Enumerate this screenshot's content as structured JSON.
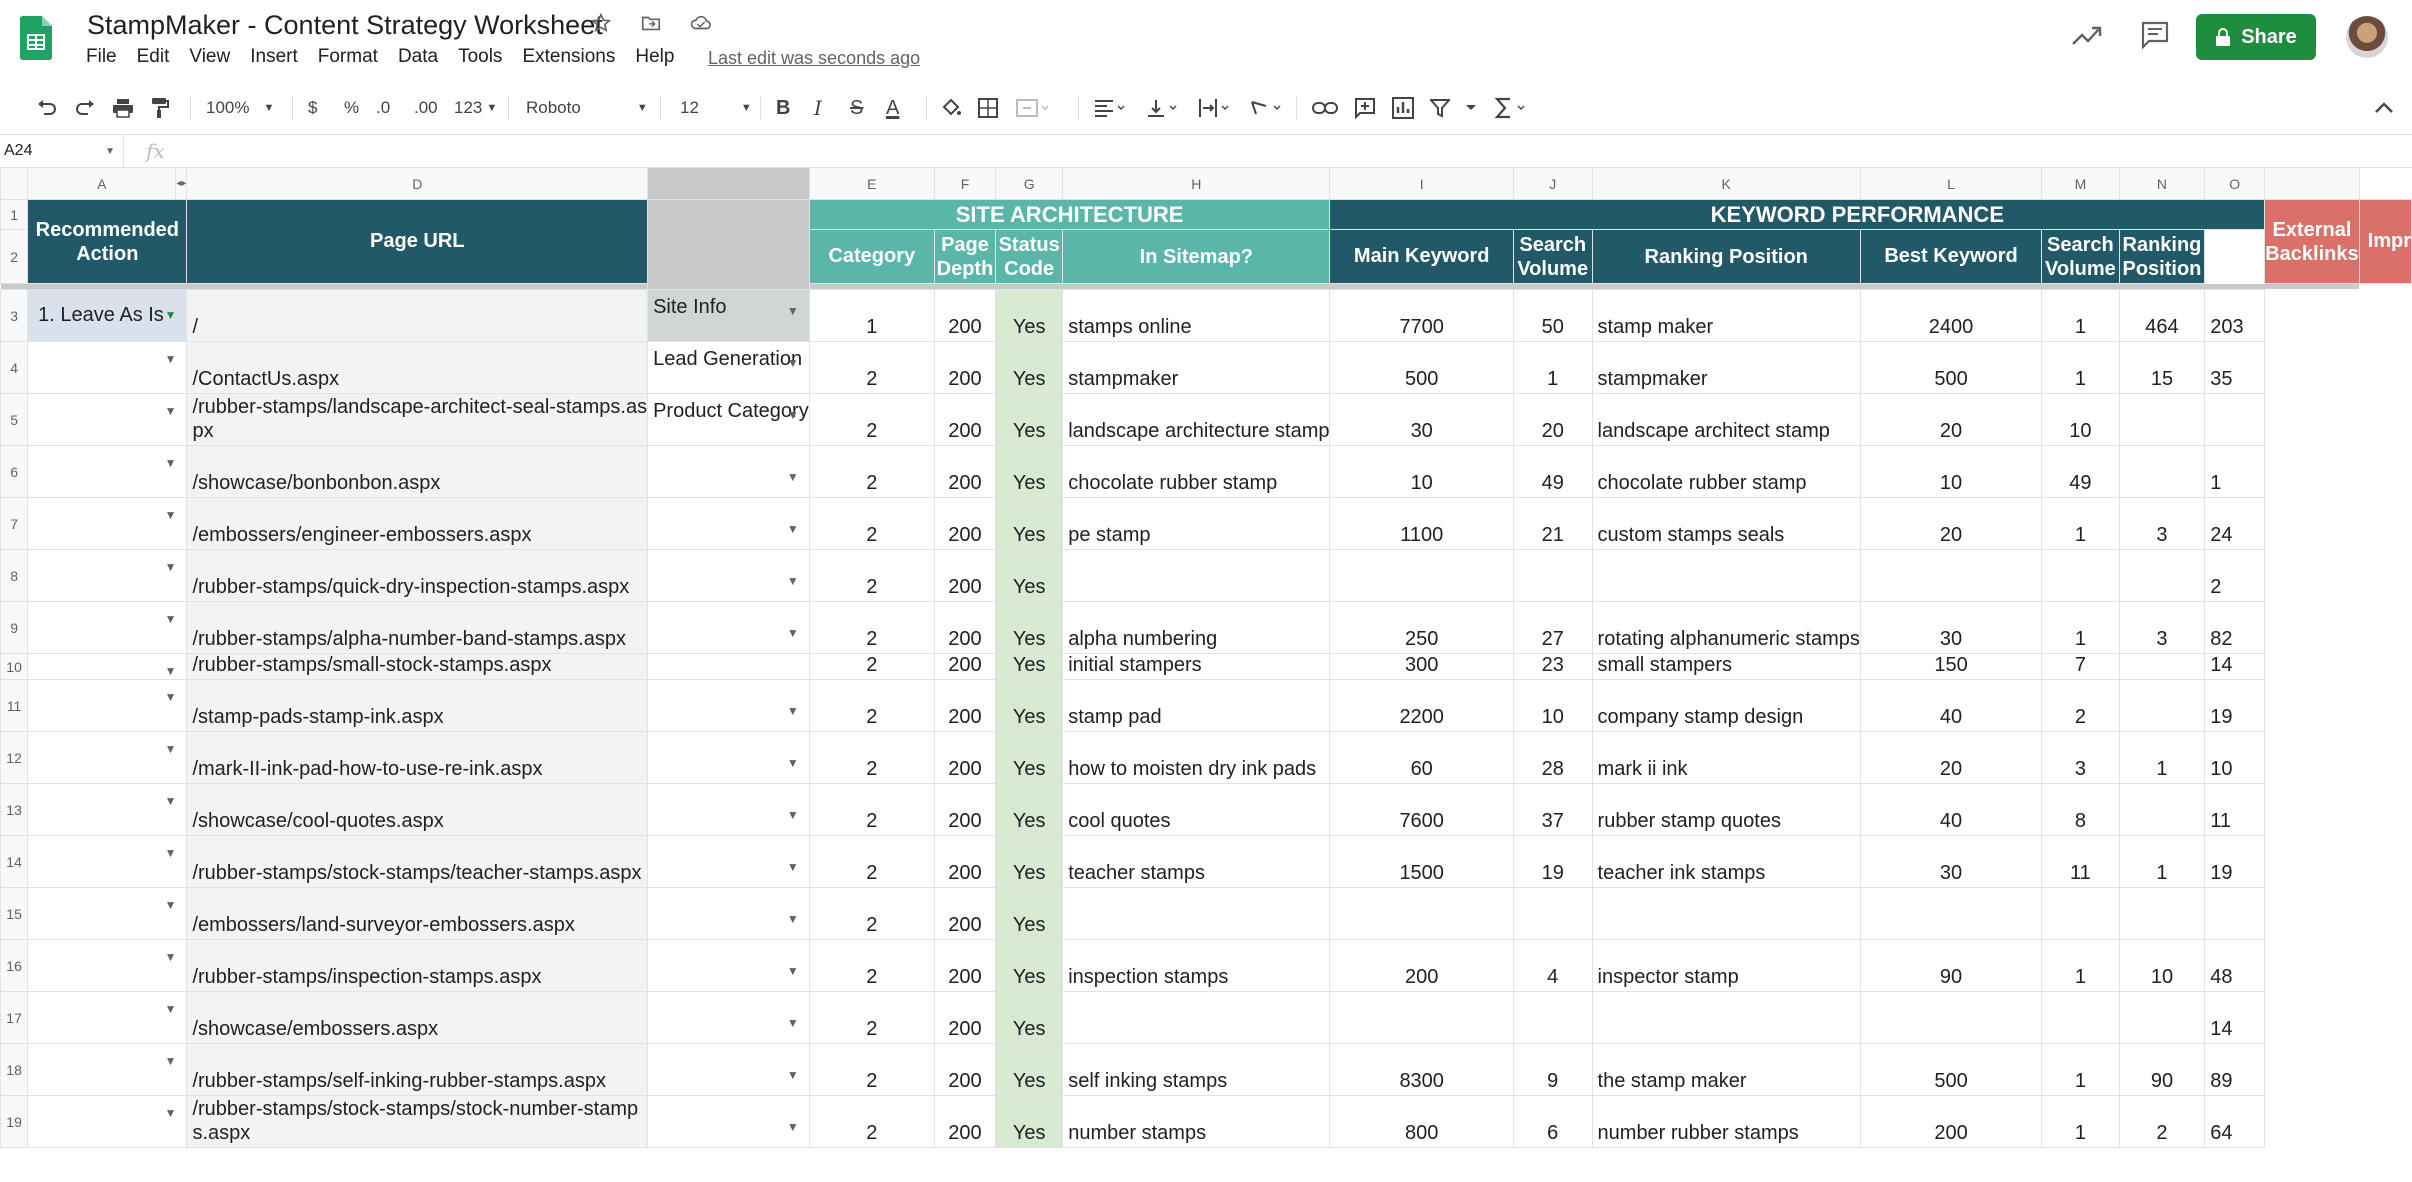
{
  "app": {
    "title": "StampMaker - Content Strategy Worksheet",
    "menu": [
      "File",
      "Edit",
      "View",
      "Insert",
      "Format",
      "Data",
      "Tools",
      "Extensions",
      "Help"
    ],
    "last_edit": "Last edit was seconds ago",
    "share_label": "Share"
  },
  "toolbar": {
    "zoom": "100%",
    "currency": "$",
    "percent": "%",
    "dec_decrease": ".0",
    "dec_increase": ".00",
    "more_formats": "123",
    "font": "Roboto",
    "font_size": "12",
    "bold": "B",
    "italic": "I",
    "strike": "S",
    "text_color": "A"
  },
  "formula_bar": {
    "cell_ref": "A24",
    "fx": "fx"
  },
  "columns": [
    "A",
    "D",
    "E",
    "F",
    "G",
    "H",
    "I",
    "J",
    "K",
    "L",
    "M",
    "N",
    "O"
  ],
  "header": {
    "site_architecture": "SITE ARCHITECTURE",
    "keyword_performance": "KEYWORD PERFORMANCE",
    "recommended_action": "Recommended Action",
    "page_url": "Page URL",
    "category": "Category",
    "page_depth": "Page Depth",
    "status_code": "Status Code",
    "in_sitemap": "In Sitemap?",
    "main_keyword": "Main Keyword",
    "search_volume_1": "Search Volume",
    "ranking_position_1": "Ranking Position",
    "best_keyword": "Best Keyword",
    "search_volume_2": "Search Volume",
    "ranking_position_2": "Ranking Position",
    "external_backlinks": "External Backlinks",
    "impressions_cut": "Impr"
  },
  "row_numbers": [
    "1",
    "2",
    "3",
    "4",
    "5",
    "6",
    "7",
    "8",
    "9",
    "10",
    "11",
    "12",
    "13",
    "14",
    "15",
    "16",
    "17",
    "18",
    "19"
  ],
  "rows": [
    {
      "n": "3",
      "action": "1. Leave As Is",
      "url": "/",
      "category": "Site Info",
      "depth": "1",
      "status": "200",
      "sitemap": "Yes",
      "main_kw": "stamps online",
      "vol1": "7700",
      "rank1": "50",
      "best_kw": "stamp maker",
      "vol2": "2400",
      "rank2": "1",
      "backlinks": "464",
      "impr": "203"
    },
    {
      "n": "4",
      "action": "",
      "url": "/ContactUs.aspx",
      "category": "Lead Generation",
      "depth": "2",
      "status": "200",
      "sitemap": "Yes",
      "main_kw": "stampmaker",
      "vol1": "500",
      "rank1": "1",
      "best_kw": "stampmaker",
      "vol2": "500",
      "rank2": "1",
      "backlinks": "15",
      "impr": "35"
    },
    {
      "n": "5",
      "action": "",
      "url": "/rubber-stamps/landscape-architect-seal-stamps.aspx",
      "category": "Product Category",
      "depth": "2",
      "status": "200",
      "sitemap": "Yes",
      "main_kw": "landscape architecture stamp",
      "vol1": "30",
      "rank1": "20",
      "best_kw": "landscape architect stamp",
      "vol2": "20",
      "rank2": "10",
      "backlinks": "",
      "impr": ""
    },
    {
      "n": "6",
      "action": "",
      "url": "/showcase/bonbonbon.aspx",
      "category": "",
      "depth": "2",
      "status": "200",
      "sitemap": "Yes",
      "main_kw": "chocolate rubber stamp",
      "vol1": "10",
      "rank1": "49",
      "best_kw": "chocolate rubber stamp",
      "vol2": "10",
      "rank2": "49",
      "backlinks": "",
      "impr": "1"
    },
    {
      "n": "7",
      "action": "",
      "url": "/embossers/engineer-embossers.aspx",
      "category": "",
      "depth": "2",
      "status": "200",
      "sitemap": "Yes",
      "main_kw": "pe stamp",
      "vol1": "1100",
      "rank1": "21",
      "best_kw": "custom stamps seals",
      "vol2": "20",
      "rank2": "1",
      "backlinks": "3",
      "impr": "24"
    },
    {
      "n": "8",
      "action": "",
      "url": "/rubber-stamps/quick-dry-inspection-stamps.aspx",
      "category": "",
      "depth": "2",
      "status": "200",
      "sitemap": "Yes",
      "main_kw": "",
      "vol1": "",
      "rank1": "",
      "best_kw": "",
      "vol2": "",
      "rank2": "",
      "backlinks": "",
      "impr": "2"
    },
    {
      "n": "9",
      "action": "",
      "url": "/rubber-stamps/alpha-number-band-stamps.aspx",
      "category": "",
      "depth": "2",
      "status": "200",
      "sitemap": "Yes",
      "main_kw": "alpha numbering",
      "vol1": "250",
      "rank1": "27",
      "best_kw": "rotating alphanumeric stamps",
      "vol2": "30",
      "rank2": "1",
      "backlinks": "3",
      "impr": "82"
    },
    {
      "n": "10",
      "action": "",
      "url": "/rubber-stamps/small-stock-stamps.aspx",
      "category": "",
      "depth": "2",
      "status": "200",
      "sitemap": "Yes",
      "main_kw": "initial stampers",
      "vol1": "300",
      "rank1": "23",
      "best_kw": "small stampers",
      "vol2": "150",
      "rank2": "7",
      "backlinks": "",
      "impr": "14"
    },
    {
      "n": "11",
      "action": "",
      "url": "/stamp-pads-stamp-ink.aspx",
      "category": "",
      "depth": "2",
      "status": "200",
      "sitemap": "Yes",
      "main_kw": "stamp pad",
      "vol1": "2200",
      "rank1": "10",
      "best_kw": "company stamp design",
      "vol2": "40",
      "rank2": "2",
      "backlinks": "",
      "impr": "19"
    },
    {
      "n": "12",
      "action": "",
      "url": "/mark-II-ink-pad-how-to-use-re-ink.aspx",
      "category": "",
      "depth": "2",
      "status": "200",
      "sitemap": "Yes",
      "main_kw": "how to moisten dry ink pads",
      "vol1": "60",
      "rank1": "28",
      "best_kw": "mark ii ink",
      "vol2": "20",
      "rank2": "3",
      "backlinks": "1",
      "impr": "10"
    },
    {
      "n": "13",
      "action": "",
      "url": "/showcase/cool-quotes.aspx",
      "category": "",
      "depth": "2",
      "status": "200",
      "sitemap": "Yes",
      "main_kw": "cool quotes",
      "vol1": "7600",
      "rank1": "37",
      "best_kw": "rubber stamp quotes",
      "vol2": "40",
      "rank2": "8",
      "backlinks": "",
      "impr": "11"
    },
    {
      "n": "14",
      "action": "",
      "url": "/rubber-stamps/stock-stamps/teacher-stamps.aspx",
      "category": "",
      "depth": "2",
      "status": "200",
      "sitemap": "Yes",
      "main_kw": "teacher stamps",
      "vol1": "1500",
      "rank1": "19",
      "best_kw": "teacher ink stamps",
      "vol2": "30",
      "rank2": "11",
      "backlinks": "1",
      "impr": "19"
    },
    {
      "n": "15",
      "action": "",
      "url": "/embossers/land-surveyor-embossers.aspx",
      "category": "",
      "depth": "2",
      "status": "200",
      "sitemap": "Yes",
      "main_kw": "",
      "vol1": "",
      "rank1": "",
      "best_kw": "",
      "vol2": "",
      "rank2": "",
      "backlinks": "",
      "impr": ""
    },
    {
      "n": "16",
      "action": "",
      "url": "/rubber-stamps/inspection-stamps.aspx",
      "category": "",
      "depth": "2",
      "status": "200",
      "sitemap": "Yes",
      "main_kw": "inspection stamps",
      "vol1": "200",
      "rank1": "4",
      "best_kw": "inspector stamp",
      "vol2": "90",
      "rank2": "1",
      "backlinks": "10",
      "impr": "48"
    },
    {
      "n": "17",
      "action": "",
      "url": "/showcase/embossers.aspx",
      "category": "",
      "depth": "2",
      "status": "200",
      "sitemap": "Yes",
      "main_kw": "",
      "vol1": "",
      "rank1": "",
      "best_kw": "",
      "vol2": "",
      "rank2": "",
      "backlinks": "",
      "impr": "14"
    },
    {
      "n": "18",
      "action": "",
      "url": "/rubber-stamps/self-inking-rubber-stamps.aspx",
      "category": "",
      "depth": "2",
      "status": "200",
      "sitemap": "Yes",
      "main_kw": "self inking stamps",
      "vol1": "8300",
      "rank1": "9",
      "best_kw": "the stamp maker",
      "vol2": "500",
      "rank2": "1",
      "backlinks": "90",
      "impr": "89"
    },
    {
      "n": "19",
      "action": "",
      "url": "/rubber-stamps/stock-stamps/stock-number-stamps.aspx",
      "category": "",
      "depth": "2",
      "status": "200",
      "sitemap": "Yes",
      "main_kw": "number stamps",
      "vol1": "800",
      "rank1": "6",
      "best_kw": "number rubber stamps",
      "vol2": "200",
      "rank2": "1",
      "backlinks": "2",
      "impr": "64"
    }
  ],
  "colors": {
    "dark_header": "#215968",
    "teal_header": "#5bb6aa",
    "red_header": "#d9706a",
    "sitemap_fill": "#d9ead3",
    "share_green": "#1e8e3e"
  }
}
